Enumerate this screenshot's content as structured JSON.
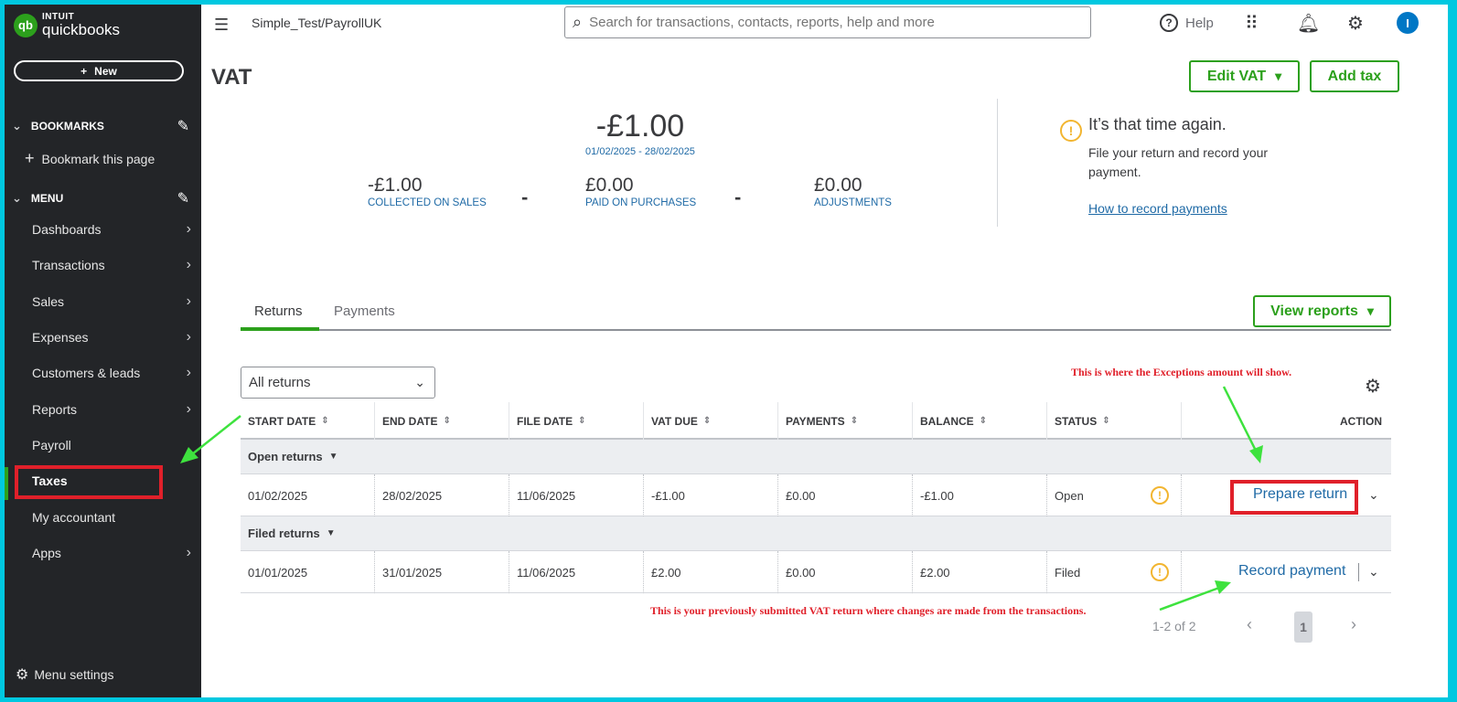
{
  "brand": {
    "intuit": "INTUIT",
    "product": "quickbooks",
    "logo_mark": "qb"
  },
  "sidebar": {
    "new_label": "New",
    "bookmarks_label": "BOOKMARKS",
    "bookmark_page": "Bookmark this page",
    "menu_label": "MENU",
    "items": [
      {
        "label": "Dashboards",
        "has_arrow": true
      },
      {
        "label": "Transactions",
        "has_arrow": true
      },
      {
        "label": "Sales",
        "has_arrow": true
      },
      {
        "label": "Expenses",
        "has_arrow": true
      },
      {
        "label": "Customers & leads",
        "has_arrow": true
      },
      {
        "label": "Reports",
        "has_arrow": true
      },
      {
        "label": "Payroll",
        "has_arrow": false
      },
      {
        "label": "Taxes",
        "has_arrow": false,
        "active": true
      },
      {
        "label": "My accountant",
        "has_arrow": false
      },
      {
        "label": "Apps",
        "has_arrow": true
      }
    ],
    "menu_settings": "Menu settings"
  },
  "topbar": {
    "company": "Simple_Test/PayrollUK",
    "search_placeholder": "Search for transactions, contacts, reports, help and more",
    "help_label": "Help",
    "user_initial": "I"
  },
  "page": {
    "title": "VAT",
    "edit_vat_label": "Edit VAT",
    "add_tax_label": "Add tax"
  },
  "summary": {
    "total": "-£1.00",
    "period": "01/02/2025 - 28/02/2025",
    "collected_amount": "-£1.00",
    "collected_label": "COLLECTED ON SALES",
    "paid_amount": "£0.00",
    "paid_label": "PAID ON PURCHASES",
    "adjust_amount": "£0.00",
    "adjust_label": "ADJUSTMENTS",
    "operator": "-"
  },
  "alert": {
    "title": "It’s that time again.",
    "body": "File your return and record your payment.",
    "link": "How to record payments"
  },
  "tabs": {
    "returns": "Returns",
    "payments": "Payments"
  },
  "view_reports_label": "View reports",
  "filter": {
    "value": "All returns"
  },
  "table": {
    "columns": [
      "START DATE",
      "END DATE",
      "FILE DATE",
      "VAT DUE",
      "PAYMENTS",
      "BALANCE",
      "STATUS",
      "ACTION"
    ],
    "groups": [
      {
        "label": "Open returns",
        "rows": [
          {
            "start": "01/02/2025",
            "end": "28/02/2025",
            "file": "11/06/2025",
            "vat_due": "-£1.00",
            "payments": "£0.00",
            "balance": "-£1.00",
            "status": "Open",
            "action": "Prepare return"
          }
        ]
      },
      {
        "label": "Filed returns",
        "rows": [
          {
            "start": "01/01/2025",
            "end": "31/01/2025",
            "file": "11/06/2025",
            "vat_due": "£2.00",
            "payments": "£0.00",
            "balance": "£2.00",
            "status": "Filed",
            "action": "Record payment"
          }
        ]
      }
    ]
  },
  "pagination": {
    "range": "1-2 of 2",
    "current": "1",
    "prev": "‹",
    "next": "›"
  },
  "annotations": {
    "exceptions": "This is where the Exceptions amount will show.",
    "previous": "This is your previously submitted VAT return where changes are made from the transactions."
  },
  "colors": {
    "brand_green": "#2ca01c",
    "link_blue": "#1f6aa6",
    "annotation_red": "#e0202a",
    "warning_yellow": "#f2b530",
    "sidebar_bg": "#232528"
  }
}
